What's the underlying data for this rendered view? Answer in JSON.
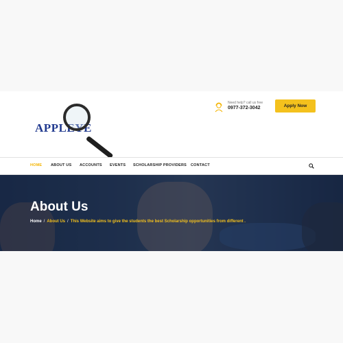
{
  "brand": {
    "logo_text": "APPLEYE"
  },
  "header": {
    "help_text": "Need help? call us free",
    "phone": "0977-372-3042",
    "apply_label": "Apply Now"
  },
  "nav": {
    "items": [
      {
        "label": "HOME",
        "active": true
      },
      {
        "label": "ABOUT US"
      },
      {
        "label": "ACCOUNTS"
      },
      {
        "label": "EVENTS"
      },
      {
        "label": "SCHOLARSHIP PROVIDERS"
      },
      {
        "label": "CONTACT"
      }
    ],
    "search_icon": "search-icon"
  },
  "hero": {
    "title": "About Us",
    "breadcrumb": {
      "home": "Home",
      "separator": "/",
      "current": "About Us",
      "description": "This Website aims to give the students the best Scholarship opportunities from different ."
    }
  },
  "colors": {
    "accent": "#f4c11d",
    "active_nav": "#f4b400",
    "logo_blue": "#213a8f",
    "hero_overlay": "#142646"
  }
}
